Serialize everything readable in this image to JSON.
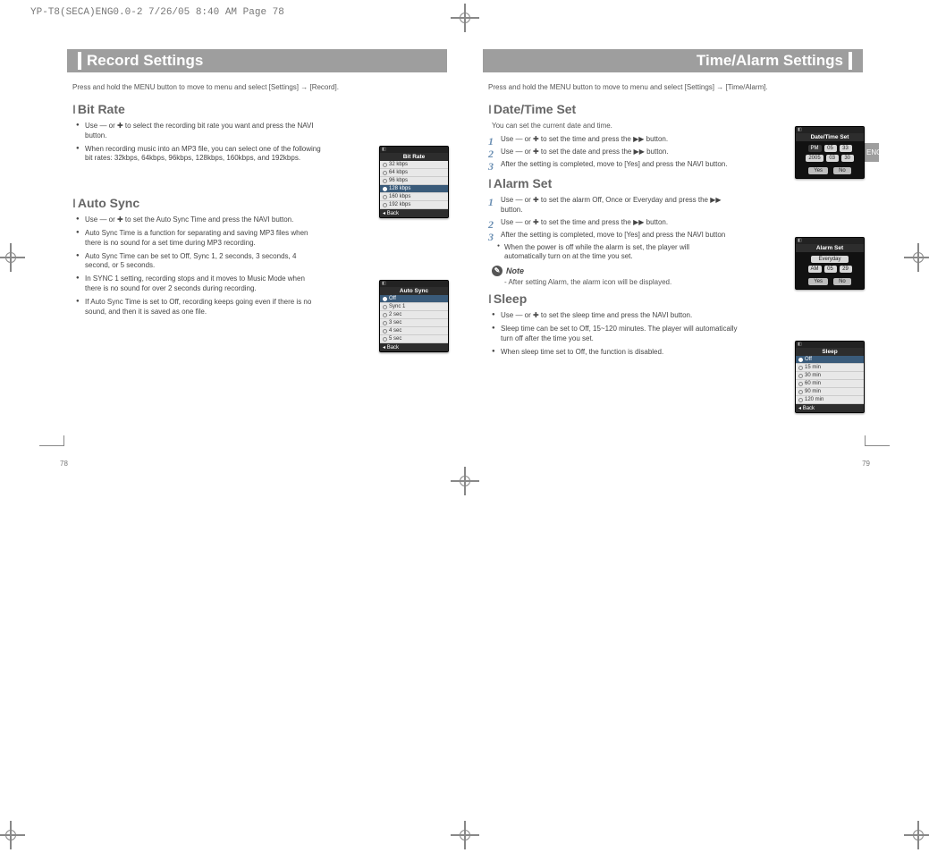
{
  "print_header": "YP-T8(SECA)ENG0.0-2  7/26/05 8:40 AM  Page 78",
  "eng_tab": "ENG",
  "page_left_num": "78",
  "page_right_num": "79",
  "left": {
    "title": "Record Settings",
    "intro": "Press and hold the MENU button to move to menu and select [Settings] → [Record].",
    "bitrate": {
      "heading": "Bit Rate",
      "bullets": [
        "Use — or ✚ to select the recording bit rate you want and press the NAVI button.",
        "When recording music into an MP3 file, you can select one of the following bit rates: 32kbps, 64kbps, 96kbps, 128kbps, 160kbps, and 192kbps."
      ]
    },
    "autosync": {
      "heading": "Auto Sync",
      "bullets": [
        "Use — or ✚ to set the Auto Sync Time and press the NAVI button.",
        "Auto Sync Time is a function for separating and saving MP3 files when there is no sound for a set time during MP3 recording.",
        "Auto Sync Time can be set to Off, Sync 1, 2 seconds, 3 seconds, 4 second, or 5 seconds.",
        "In SYNC 1 setting, recording stops and it moves to Music Mode when there is no sound for over 2 seconds during recording.",
        "If Auto Sync Time is set to Off, recording keeps going even if there is no sound, and then it is saved as one file."
      ]
    },
    "screen_bitrate": {
      "title": "Bit Rate",
      "items": [
        "32 kbps",
        "64 kbps",
        "96 kbps",
        "128 kbps",
        "160 kbps",
        "192 kbps"
      ],
      "selected": "128 kbps",
      "back": "Back"
    },
    "screen_autosync": {
      "title": "Auto Sync",
      "items": [
        "Off",
        "Sync 1",
        "2 sec",
        "3 sec",
        "4 sec",
        "5 sec"
      ],
      "selected": "Off",
      "back": "Back"
    }
  },
  "right": {
    "title": "Time/Alarm Settings",
    "intro": "Press and hold the MENU button to move to menu and select [Settings] → [Time/Alarm].",
    "datetime": {
      "heading": "Date/Time Set",
      "sub": "You can set the current date and time.",
      "steps": [
        "Use — or ✚ to set the time and press the ▶▶ button.",
        "Use — or ✚ to set the date and press the ▶▶ button.",
        "After the setting is completed, move to [Yes] and press the NAVI button."
      ]
    },
    "alarm": {
      "heading": "Alarm Set",
      "steps": [
        "Use — or ✚ to set the alarm Off, Once or Everyday and press the ▶▶ button.",
        "Use — or ✚ to set the time and press the ▶▶ button.",
        "After the setting is completed, move to [Yes] and press the NAVI button"
      ],
      "sub_bullet": "When the power is off while the alarm is set, the player will automatically turn on at the time you set.",
      "note_label": "Note",
      "note_text": "- After setting Alarm, the alarm icon will be displayed."
    },
    "sleep": {
      "heading": "Sleep",
      "bullets": [
        "Use — or ✚ to set the sleep time and press the NAVI button.",
        "Sleep time can be set to Off, 15~120 minutes. The player will automatically turn off after the time you set.",
        "When sleep time set to Off, the function is disabled."
      ]
    },
    "screen_datetime": {
      "title": "Date/Time Set",
      "ampm": "PM",
      "hh": "05",
      "mm": "33",
      "yyyy": "2005",
      "mo": "03",
      "dd": "30",
      "yes": "Yes",
      "no": "No"
    },
    "screen_alarm": {
      "title": "Alarm Set",
      "mode": "Everyday",
      "ampm": "AM",
      "hh": "05",
      "mm": "29",
      "yes": "Yes",
      "no": "No"
    },
    "screen_sleep": {
      "title": "Sleep",
      "items": [
        "Off",
        "15 min",
        "30 min",
        "60 min",
        "90 min",
        "120 min"
      ],
      "selected": "Off",
      "back": "Back"
    }
  }
}
